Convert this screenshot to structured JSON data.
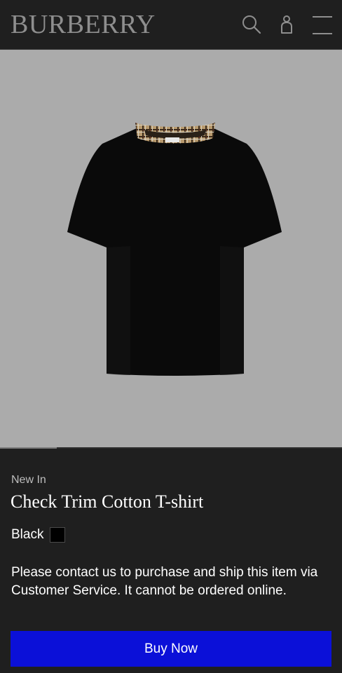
{
  "brand": "BURBERRY",
  "header": {
    "icons": [
      "search-icon",
      "account-icon",
      "menu-icon"
    ]
  },
  "gallery": {
    "image_label": "black-tshirt-check-trim",
    "progress_fraction": 0.166
  },
  "product": {
    "badge": "New In",
    "title": "Check Trim Cotton T-shirt",
    "color_name": "Black",
    "color_hex": "#000000",
    "notice": "Please contact us to purchase and ship this item via Customer Service. It cannot be ordered online."
  },
  "actions": {
    "buy_label": "Buy Now"
  },
  "colors": {
    "background": "#1f1f1f",
    "image_background": "#ababab",
    "button": "#0b10d8"
  }
}
